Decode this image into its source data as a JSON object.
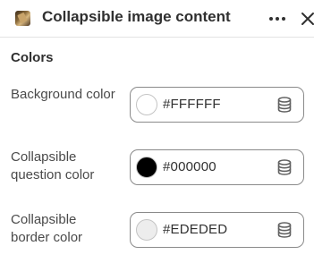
{
  "header": {
    "title": "Collapsible image content",
    "thumbnail_icon": "image-thumbnail-icon",
    "more_icon": "more-horizontal-icon",
    "close_icon": "close-icon"
  },
  "section": {
    "title": "Colors"
  },
  "colors": [
    {
      "label": "Background color",
      "value": "#FFFFFF",
      "swatch": "#FFFFFF"
    },
    {
      "label": "Collapsible question color",
      "value": "#000000",
      "swatch": "#000000"
    },
    {
      "label": "Collapsible border color",
      "value": "#EDEDED",
      "swatch": "#EDEDED"
    }
  ],
  "icons": {
    "dynamic_source": "database-icon"
  }
}
